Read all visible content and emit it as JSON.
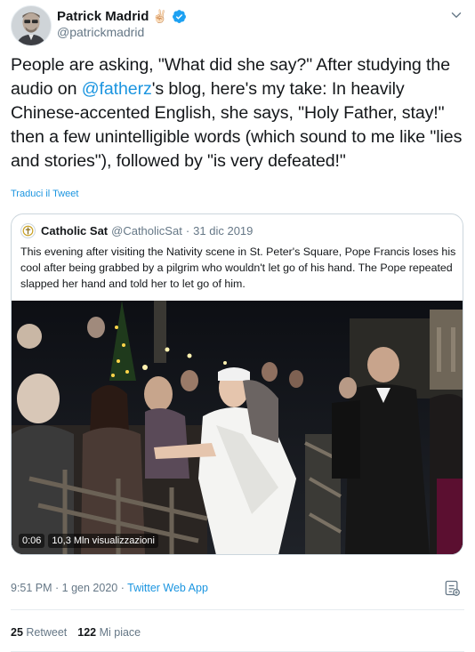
{
  "author": {
    "display_name": "Patrick Madrid",
    "emoji": "✌🏻",
    "handle": "@patrickmadrid",
    "avatar_icon": "profile-photo",
    "verified_icon": "verified-badge-icon"
  },
  "tweet": {
    "text_before": "People are asking, \"What did she say?\" After studying the audio on ",
    "mention": "@fatherz",
    "text_after": "'s blog, here's my take: In heavily Chinese-accented English, she says, \"Holy Father, stay!\" then a few unintelligible words (which sound to me like \"lies and stories\"), followed by \"is very defeated!\""
  },
  "translate_link": "Traduci il Tweet",
  "quoted": {
    "name": "Catholic Sat",
    "handle": "@CatholicSat",
    "separator": "·",
    "date": "31 dic 2019",
    "text": "This evening after visiting the Nativity scene in St. Peter's Square, Pope Francis loses his cool after being grabbed by a pilgrim who wouldn't let go of his hand. The Pope repeated slapped her hand and told her to let go of him.",
    "video": {
      "duration": "0:06",
      "views": "10,3 Mln visualizzazioni"
    }
  },
  "meta": {
    "time": "9:51 PM",
    "separator1": " · ",
    "date": "1 gen 2020",
    "separator2": " · ",
    "source": "Twitter Web App"
  },
  "stats": {
    "retweets_count": "25",
    "retweets_label": "Retweet",
    "likes_count": "122",
    "likes_label": "Mi piace"
  },
  "colors": {
    "link": "#1b95e0",
    "secondary_text": "#657786",
    "border": "#ccd6dd"
  }
}
